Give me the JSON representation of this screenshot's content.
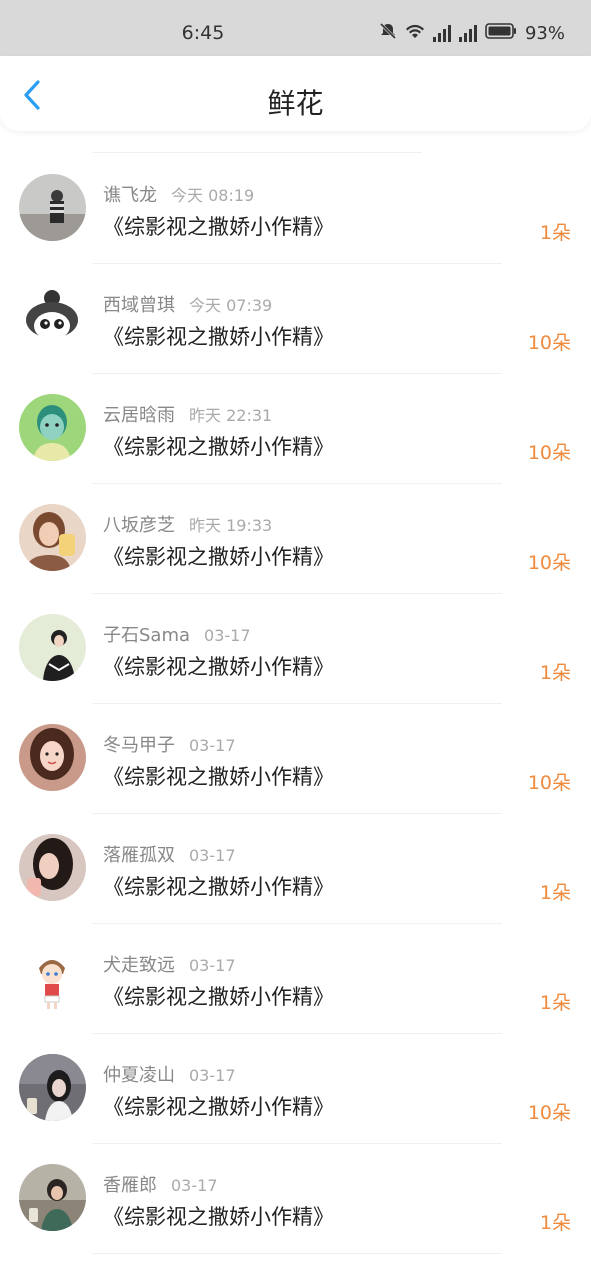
{
  "status_bar": {
    "time": "6:45",
    "battery": "93%"
  },
  "header": {
    "title": "鲜花"
  },
  "items": [
    {
      "name": "谯飞龙",
      "time": "今天 08:19",
      "book": "《综影视之撒娇小作精》",
      "count": "1朵"
    },
    {
      "name": "西域曾琪",
      "time": "今天 07:39",
      "book": "《综影视之撒娇小作精》",
      "count": "10朵"
    },
    {
      "name": "云居晗雨",
      "time": "昨天 22:31",
      "book": "《综影视之撒娇小作精》",
      "count": "10朵"
    },
    {
      "name": "八坂彦芝",
      "time": "昨天 19:33",
      "book": "《综影视之撒娇小作精》",
      "count": "10朵"
    },
    {
      "name": "子石Sama",
      "time": "03-17",
      "book": "《综影视之撒娇小作精》",
      "count": "1朵"
    },
    {
      "name": "冬马甲子",
      "time": "03-17",
      "book": "《综影视之撒娇小作精》",
      "count": "10朵"
    },
    {
      "name": "落雁孤双",
      "time": "03-17",
      "book": "《综影视之撒娇小作精》",
      "count": "1朵"
    },
    {
      "name": "犬走致远",
      "time": "03-17",
      "book": "《综影视之撒娇小作精》",
      "count": "1朵"
    },
    {
      "name": "仲夏凌山",
      "time": "03-17",
      "book": "《综影视之撒娇小作精》",
      "count": "10朵"
    },
    {
      "name": "香雁郎",
      "time": "03-17",
      "book": "《综影视之撒娇小作精》",
      "count": "1朵"
    }
  ]
}
